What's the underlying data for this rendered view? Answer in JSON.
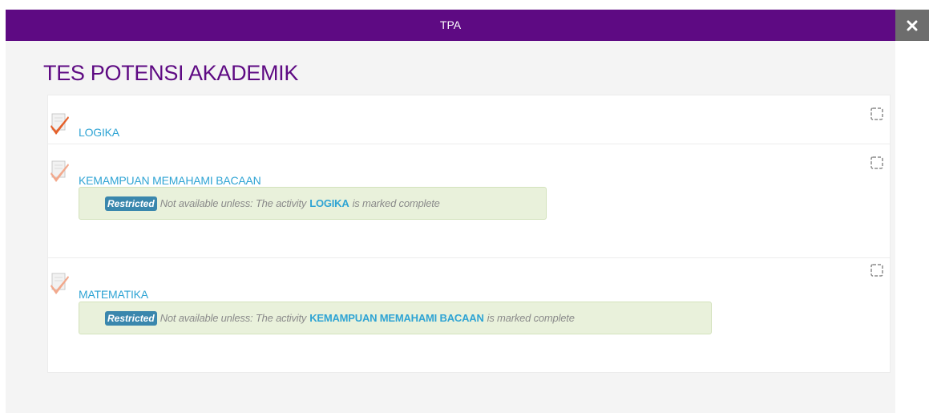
{
  "modal": {
    "title": "TPA",
    "close_icon": "close-icon",
    "header_color": "#5e0a83"
  },
  "page": {
    "title": "TES POTENSI AKADEMIK"
  },
  "activities": [
    {
      "name": "LOGIKA",
      "icon": "quiz-check-icon",
      "restricted": false
    },
    {
      "name": "KEMAMPUAN MEMAHAMI BACAAN",
      "icon": "quiz-check-icon",
      "restricted": true,
      "restriction": {
        "badge": "Restricted",
        "prefix": "Not available unless: The activity",
        "activity": "LOGIKA",
        "suffix": "is marked complete"
      }
    },
    {
      "name": "MATEMATIKA",
      "icon": "quiz-check-icon",
      "restricted": true,
      "restriction": {
        "badge": "Restricted",
        "prefix": "Not available unless: The activity",
        "activity": "KEMAMPUAN MEMAHAMI BACAAN",
        "suffix": "is marked complete"
      }
    }
  ],
  "colors": {
    "link": "#2fa4d4",
    "badge": "#3a87ad",
    "restriction_bg": "#e9f1db"
  }
}
